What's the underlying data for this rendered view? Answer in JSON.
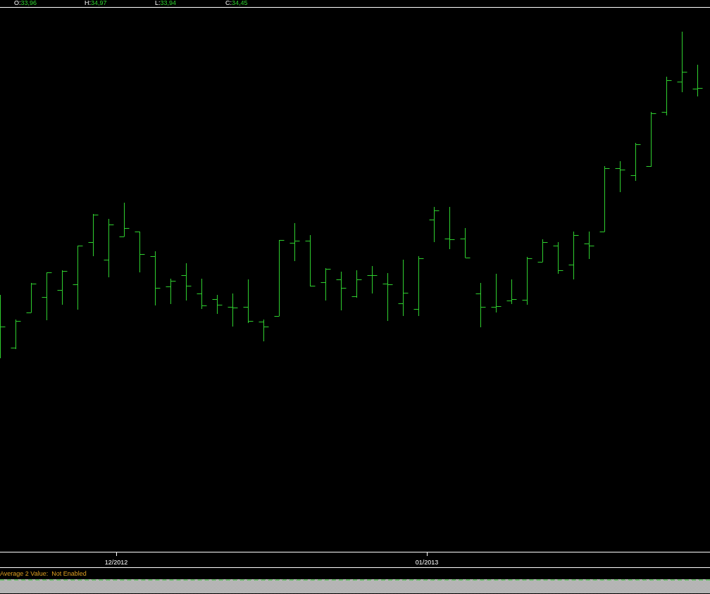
{
  "legend": [
    {
      "label": "O:",
      "value": "33,96"
    },
    {
      "label": "H:",
      "value": "34,97"
    },
    {
      "label": "L:",
      "value": "33,94"
    },
    {
      "label": "C:",
      "value": "34,45"
    }
  ],
  "x_axis": {
    "labels": [
      "12/2012",
      "01/2013"
    ]
  },
  "status_bar": {
    "text": "Average 2 Value:  Not Enabled"
  }
}
